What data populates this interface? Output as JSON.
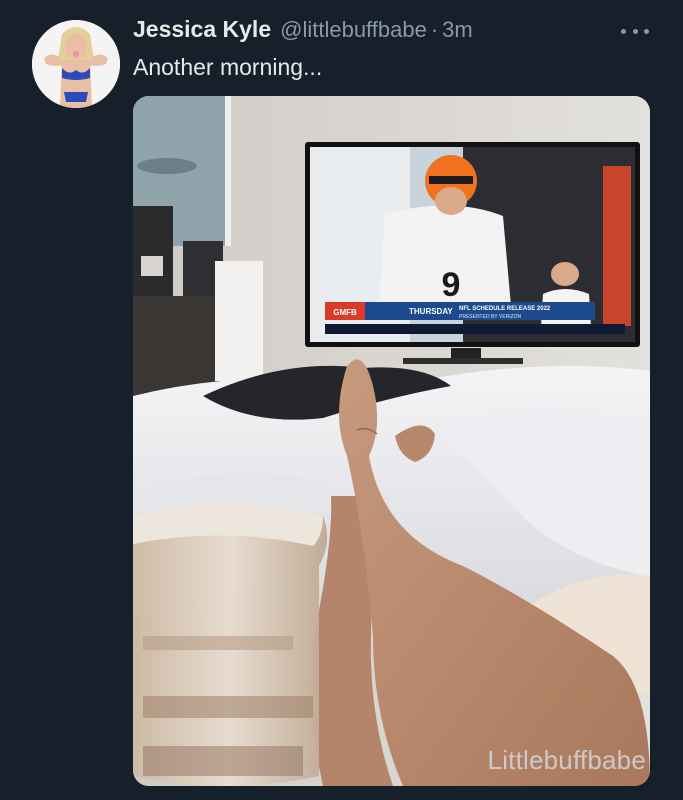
{
  "tweet": {
    "display_name": "Jessica Kyle",
    "handle": "@littlebuffbabe",
    "separator": "·",
    "time": "3m",
    "text": "Another morning..."
  },
  "media": {
    "description_icon": "photo",
    "tv_banner": {
      "badge": "GMFB",
      "day": "THURSDAY",
      "headline": "NFL SCHEDULE RELEASE 2022",
      "sub": "PRESENTED BY VERIZON",
      "number": "9"
    }
  },
  "watermark": "Littlebuffbabe",
  "colors": {
    "background": "#15202b",
    "text_primary": "#e7e9ea",
    "text_secondary": "#8b98a5"
  }
}
